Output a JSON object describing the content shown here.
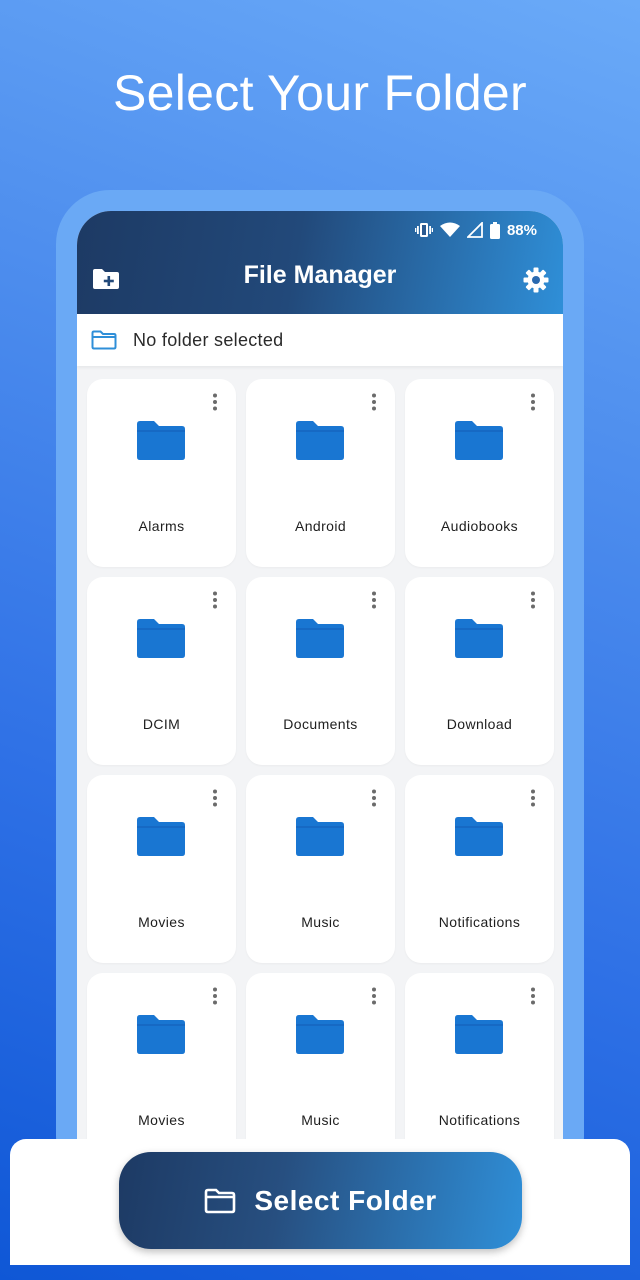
{
  "headline": "Select Your Folder",
  "status_bar": {
    "battery": "88%",
    "icons": [
      "vibrate-icon",
      "wifi-icon",
      "signal-icon",
      "battery-icon"
    ]
  },
  "app_bar": {
    "title": "File Manager",
    "left_icon": "new-folder-icon",
    "right_icon": "settings-gear-icon"
  },
  "folder_bar": {
    "text": "No folder selected",
    "icon": "folder-outline-icon"
  },
  "folders": [
    {
      "name": "Alarms"
    },
    {
      "name": "Android"
    },
    {
      "name": "Audiobooks"
    },
    {
      "name": "DCIM"
    },
    {
      "name": "Documents"
    },
    {
      "name": "Download"
    },
    {
      "name": "Movies"
    },
    {
      "name": "Music"
    },
    {
      "name": "Notifications"
    },
    {
      "name": "Movies"
    },
    {
      "name": "Music"
    },
    {
      "name": "Notifications"
    }
  ],
  "bottom": {
    "button_label": "Select Folder",
    "button_icon": "folder-outline-icon"
  },
  "colors": {
    "folder_blue": "#1976d2",
    "accent_dark": "#1d3a64",
    "accent_light": "#2f8fd8"
  }
}
